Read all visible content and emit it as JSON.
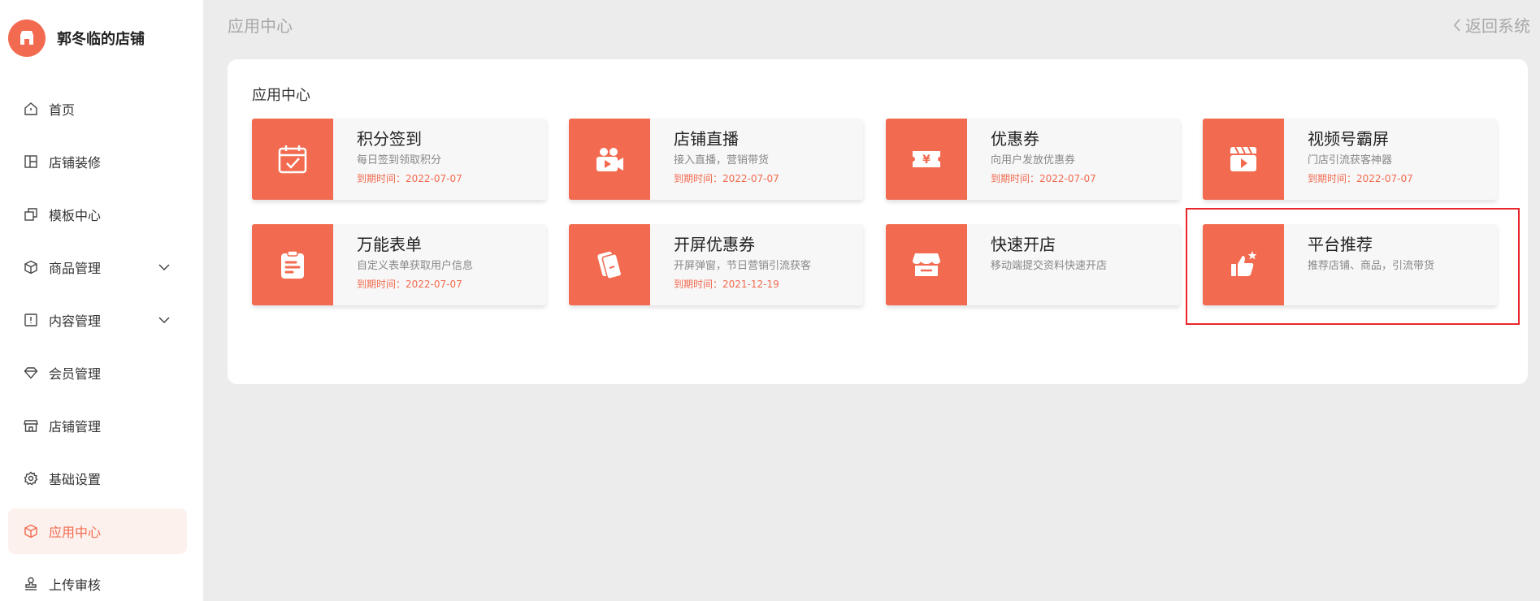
{
  "sidebar": {
    "shop_name": "郭冬临的店铺",
    "items": [
      {
        "label": "首页",
        "icon": "home-icon"
      },
      {
        "label": "店铺装修",
        "icon": "layout-icon"
      },
      {
        "label": "模板中心",
        "icon": "copy-icon"
      },
      {
        "label": "商品管理",
        "icon": "box-icon",
        "expandable": true
      },
      {
        "label": "内容管理",
        "icon": "book-icon",
        "expandable": true
      },
      {
        "label": "会员管理",
        "icon": "diamond-icon"
      },
      {
        "label": "店铺管理",
        "icon": "store-icon"
      },
      {
        "label": "基础设置",
        "icon": "gear-icon"
      },
      {
        "label": "应用中心",
        "icon": "cube-icon",
        "active": true
      },
      {
        "label": "上传审核",
        "icon": "stamp-icon"
      }
    ]
  },
  "header": {
    "title": "应用中心",
    "back_label": "返回系统"
  },
  "main": {
    "section_title": "应用中心",
    "apps": [
      {
        "title": "积分签到",
        "desc": "每日签到领取积分",
        "expire": "到期时间：2022-07-07",
        "icon": "calendar-check-icon"
      },
      {
        "title": "店铺直播",
        "desc": "接入直播，营销带货",
        "expire": "到期时间：2022-07-07",
        "icon": "video-camera-icon"
      },
      {
        "title": "优惠券",
        "desc": "向用户发放优惠券",
        "expire": "到期时间：2022-07-07",
        "icon": "coupon-icon"
      },
      {
        "title": "视频号霸屏",
        "desc": "门店引流获客神器",
        "expire": "到期时间：2022-07-07",
        "icon": "clapperboard-icon"
      },
      {
        "title": "万能表单",
        "desc": "自定义表单获取用户信息",
        "expire": "到期时间：2022-07-07",
        "icon": "clipboard-icon"
      },
      {
        "title": "开屏优惠券",
        "desc": "开屏弹窗，节日营销引流获客",
        "expire": "到期时间：2021-12-19",
        "icon": "tickets-icon"
      },
      {
        "title": "快速开店",
        "desc": "移动端提交资料快速开店",
        "expire": "",
        "icon": "shop-icon"
      },
      {
        "title": "平台推荐",
        "desc": "推荐店铺、商品，引流带货",
        "expire": "",
        "icon": "thumbs-up-icon"
      }
    ]
  },
  "colors": {
    "accent": "#f26a4f",
    "highlight_border": "#e8262b",
    "background": "#ececec"
  }
}
